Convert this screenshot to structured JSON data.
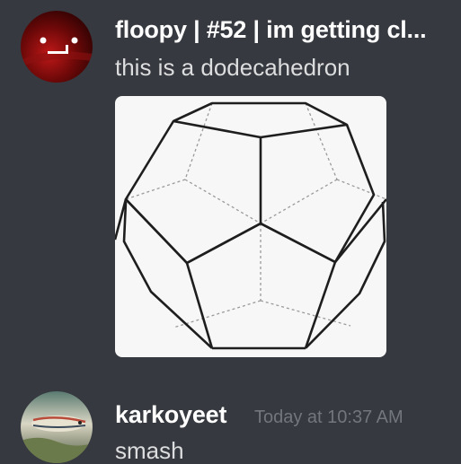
{
  "messages": [
    {
      "username": "floopy | #52 | im getting cl...",
      "text": "this is a dodecahedron",
      "avatar_icon": "red-face-avatar",
      "attachment": {
        "type": "image",
        "subject": "dodecahedron-wireframe-drawing"
      }
    },
    {
      "username": "karkoyeet",
      "timestamp": "Today at 10:37 AM",
      "text": "smash",
      "avatar_icon": "fish-avatar"
    }
  ],
  "colors": {
    "background": "#36393f",
    "username": "#ffffff",
    "message_text": "#dcddde",
    "timestamp": "#72767d"
  }
}
